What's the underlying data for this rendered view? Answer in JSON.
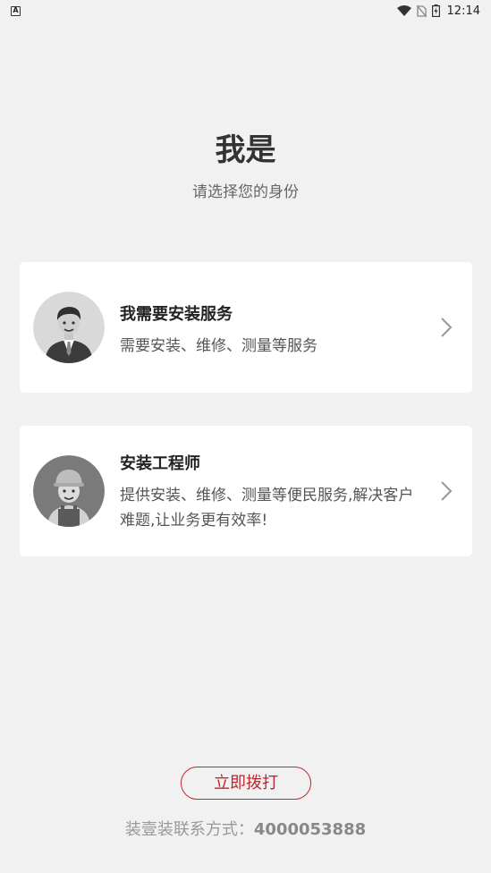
{
  "status_bar": {
    "notification_letter": "A",
    "time": "12:14",
    "icons": [
      "wifi-icon",
      "no-sim-icon",
      "battery-charging-icon"
    ]
  },
  "header": {
    "title": "我是",
    "subtitle": "请选择您的身份"
  },
  "options": [
    {
      "title": "我需要安装服务",
      "desc": "需要安装、维修、测量等服务",
      "avatar": "businessman-avatar-icon"
    },
    {
      "title": "安装工程师",
      "desc": "提供安装、维修、测量等便民服务,解决客户难题,让业务更有效率!",
      "avatar": "engineer-avatar-icon"
    }
  ],
  "footer": {
    "call_label": "立即拨打",
    "contact_label": "装壹装联系方式：",
    "phone": "4000053888"
  },
  "colors": {
    "accent": "#c0262d",
    "background": "#f1f1f1",
    "card": "#ffffff"
  }
}
